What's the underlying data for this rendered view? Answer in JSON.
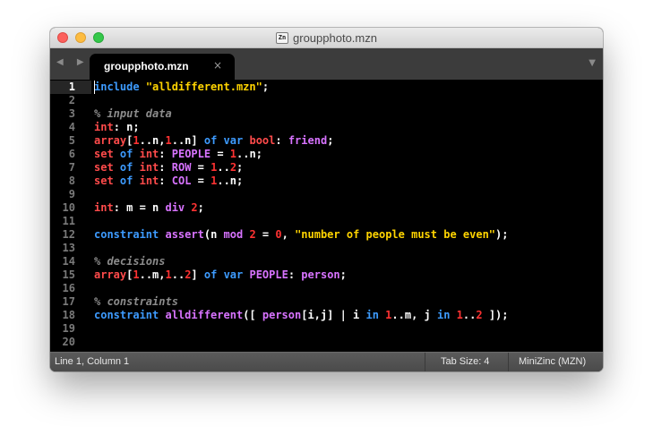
{
  "window": {
    "title": "groupphoto.mzn",
    "file_icon_label": "Zn"
  },
  "tabs": {
    "nav_arrows": "◀ ▶",
    "active_tab": {
      "label": "groupphoto.mzn",
      "close_glyph": "×"
    },
    "dropdown_glyph": "▼"
  },
  "editor": {
    "current_line": 1,
    "lines": [
      {
        "n": "1",
        "tokens": [
          {
            "c": "kw",
            "t": "include"
          },
          {
            "c": "op",
            "t": " "
          },
          {
            "c": "str",
            "t": "\"alldifferent.mzn\""
          },
          {
            "c": "op",
            "t": ";"
          }
        ]
      },
      {
        "n": "2",
        "tokens": []
      },
      {
        "n": "3",
        "tokens": [
          {
            "c": "cm",
            "t": "% input data"
          }
        ]
      },
      {
        "n": "4",
        "tokens": [
          {
            "c": "ty",
            "t": "int"
          },
          {
            "c": "op",
            "t": ": n;"
          }
        ]
      },
      {
        "n": "5",
        "tokens": [
          {
            "c": "ty",
            "t": "array"
          },
          {
            "c": "op",
            "t": "["
          },
          {
            "c": "num",
            "t": "1"
          },
          {
            "c": "op",
            "t": "..n,"
          },
          {
            "c": "num",
            "t": "1"
          },
          {
            "c": "op",
            "t": "..n] "
          },
          {
            "c": "kw",
            "t": "of"
          },
          {
            "c": "op",
            "t": " "
          },
          {
            "c": "kw",
            "t": "var"
          },
          {
            "c": "op",
            "t": " "
          },
          {
            "c": "ty",
            "t": "bool"
          },
          {
            "c": "op",
            "t": ": "
          },
          {
            "c": "id",
            "t": "friend"
          },
          {
            "c": "op",
            "t": ";"
          }
        ]
      },
      {
        "n": "6",
        "tokens": [
          {
            "c": "ty",
            "t": "set"
          },
          {
            "c": "op",
            "t": " "
          },
          {
            "c": "kw",
            "t": "of"
          },
          {
            "c": "op",
            "t": " "
          },
          {
            "c": "ty",
            "t": "int"
          },
          {
            "c": "op",
            "t": ": "
          },
          {
            "c": "id",
            "t": "PEOPLE"
          },
          {
            "c": "op",
            "t": " = "
          },
          {
            "c": "num",
            "t": "1"
          },
          {
            "c": "op",
            "t": "..n;"
          }
        ]
      },
      {
        "n": "7",
        "tokens": [
          {
            "c": "ty",
            "t": "set"
          },
          {
            "c": "op",
            "t": " "
          },
          {
            "c": "kw",
            "t": "of"
          },
          {
            "c": "op",
            "t": " "
          },
          {
            "c": "ty",
            "t": "int"
          },
          {
            "c": "op",
            "t": ": "
          },
          {
            "c": "id",
            "t": "ROW"
          },
          {
            "c": "op",
            "t": " = "
          },
          {
            "c": "num",
            "t": "1"
          },
          {
            "c": "op",
            "t": ".."
          },
          {
            "c": "num",
            "t": "2"
          },
          {
            "c": "op",
            "t": ";"
          }
        ]
      },
      {
        "n": "8",
        "tokens": [
          {
            "c": "ty",
            "t": "set"
          },
          {
            "c": "op",
            "t": " "
          },
          {
            "c": "kw",
            "t": "of"
          },
          {
            "c": "op",
            "t": " "
          },
          {
            "c": "ty",
            "t": "int"
          },
          {
            "c": "op",
            "t": ": "
          },
          {
            "c": "id",
            "t": "COL"
          },
          {
            "c": "op",
            "t": " = "
          },
          {
            "c": "num",
            "t": "1"
          },
          {
            "c": "op",
            "t": "..n;"
          }
        ]
      },
      {
        "n": "9",
        "tokens": []
      },
      {
        "n": "10",
        "tokens": [
          {
            "c": "ty",
            "t": "int"
          },
          {
            "c": "op",
            "t": ": m = n "
          },
          {
            "c": "id",
            "t": "div"
          },
          {
            "c": "op",
            "t": " "
          },
          {
            "c": "num",
            "t": "2"
          },
          {
            "c": "op",
            "t": ";"
          }
        ]
      },
      {
        "n": "11",
        "tokens": []
      },
      {
        "n": "12",
        "tokens": [
          {
            "c": "kw",
            "t": "constraint"
          },
          {
            "c": "op",
            "t": " "
          },
          {
            "c": "id",
            "t": "assert"
          },
          {
            "c": "op",
            "t": "(n "
          },
          {
            "c": "id",
            "t": "mod"
          },
          {
            "c": "op",
            "t": " "
          },
          {
            "c": "num",
            "t": "2"
          },
          {
            "c": "op",
            "t": " = "
          },
          {
            "c": "num",
            "t": "0"
          },
          {
            "c": "op",
            "t": ", "
          },
          {
            "c": "str",
            "t": "\"number of people must be even\""
          },
          {
            "c": "op",
            "t": ");"
          }
        ]
      },
      {
        "n": "13",
        "tokens": []
      },
      {
        "n": "14",
        "tokens": [
          {
            "c": "cm",
            "t": "% decisions"
          }
        ]
      },
      {
        "n": "15",
        "tokens": [
          {
            "c": "ty",
            "t": "array"
          },
          {
            "c": "op",
            "t": "["
          },
          {
            "c": "num",
            "t": "1"
          },
          {
            "c": "op",
            "t": "..m,"
          },
          {
            "c": "num",
            "t": "1"
          },
          {
            "c": "op",
            "t": ".."
          },
          {
            "c": "num",
            "t": "2"
          },
          {
            "c": "op",
            "t": "] "
          },
          {
            "c": "kw",
            "t": "of"
          },
          {
            "c": "op",
            "t": " "
          },
          {
            "c": "kw",
            "t": "var"
          },
          {
            "c": "op",
            "t": " "
          },
          {
            "c": "id",
            "t": "PEOPLE"
          },
          {
            "c": "op",
            "t": ": "
          },
          {
            "c": "id",
            "t": "person"
          },
          {
            "c": "op",
            "t": ";"
          }
        ]
      },
      {
        "n": "16",
        "tokens": []
      },
      {
        "n": "17",
        "tokens": [
          {
            "c": "cm",
            "t": "% constraints"
          }
        ]
      },
      {
        "n": "18",
        "tokens": [
          {
            "c": "kw",
            "t": "constraint"
          },
          {
            "c": "op",
            "t": " "
          },
          {
            "c": "id",
            "t": "alldifferent"
          },
          {
            "c": "op",
            "t": "([ "
          },
          {
            "c": "id",
            "t": "person"
          },
          {
            "c": "op",
            "t": "[i,j] | i "
          },
          {
            "c": "kw",
            "t": "in"
          },
          {
            "c": "op",
            "t": " "
          },
          {
            "c": "num",
            "t": "1"
          },
          {
            "c": "op",
            "t": "..m, j "
          },
          {
            "c": "kw",
            "t": "in"
          },
          {
            "c": "op",
            "t": " "
          },
          {
            "c": "num",
            "t": "1"
          },
          {
            "c": "op",
            "t": ".."
          },
          {
            "c": "num",
            "t": "2"
          },
          {
            "c": "op",
            "t": " ]);"
          }
        ]
      },
      {
        "n": "19",
        "tokens": []
      },
      {
        "n": "20",
        "tokens": []
      }
    ]
  },
  "status": {
    "position": "Line 1, Column 1",
    "tab_size": "Tab Size: 4",
    "syntax": "MiniZinc (MZN)"
  },
  "colors": {
    "keyword": "#3d9bff",
    "type": "#ff4b4b",
    "number": "#ff3232",
    "string": "#ffd400",
    "comment": "#8c8c8c",
    "identifier": "#d873ff"
  }
}
